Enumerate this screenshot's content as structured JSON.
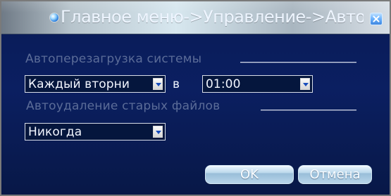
{
  "window": {
    "title": "Главное меню->Управление->Авто-фун"
  },
  "auto_restart": {
    "section_title": "Автоперезагрузка системы",
    "day_select": {
      "value": "Каждый вторни"
    },
    "at_label": "в",
    "time_select": {
      "value": "01:00"
    }
  },
  "auto_delete": {
    "section_title": "Автоудаление старых файлов",
    "mode_select": {
      "value": "Никогда"
    }
  },
  "actions": {
    "ok_label": "OK",
    "cancel_label": "Отмена"
  },
  "icons": {
    "window_icon": "window-icon",
    "close_icon": "close-icon",
    "dropdown_icon": "chevron-down-icon"
  }
}
